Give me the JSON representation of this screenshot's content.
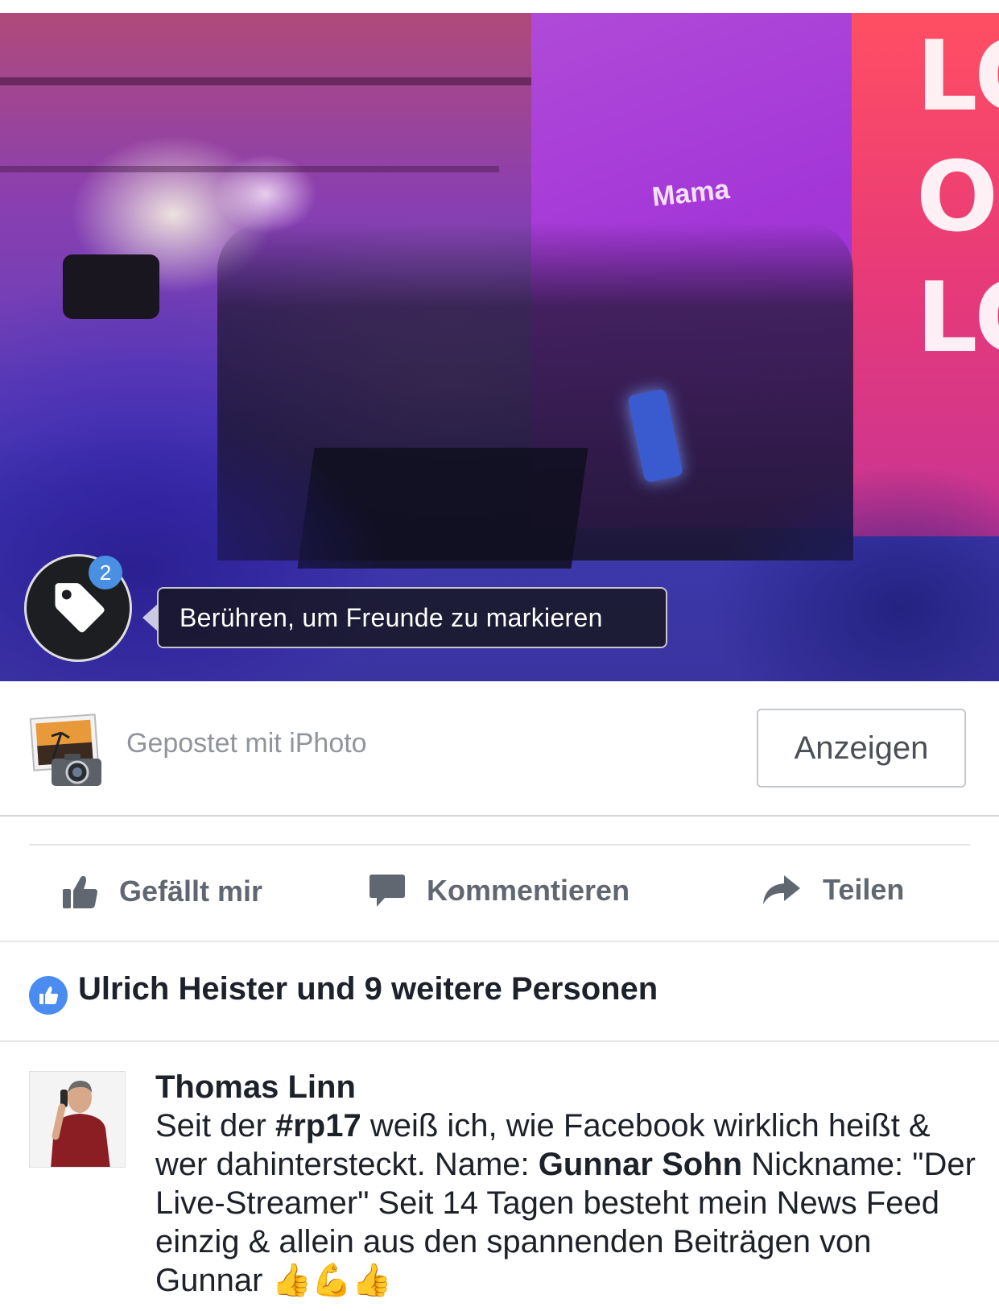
{
  "photo": {
    "banner_letters": [
      "LO",
      "O",
      "LO"
    ],
    "screen_text": "Mama",
    "tag_badge_count": "2",
    "tag_hint": "Berühren, um Freunde zu markieren",
    "tag_icon": "tag-icon"
  },
  "app_attribution": {
    "icon": "iphoto-icon",
    "label": "Gepostet mit iPhoto",
    "button_label": "Anzeigen"
  },
  "actions": {
    "like_label": "Gefällt mir",
    "comment_label": "Kommentieren",
    "share_label": "Teilen",
    "like_icon": "thumbs-up-icon",
    "comment_icon": "speech-bubble-icon",
    "share_icon": "share-arrow-icon"
  },
  "reactions": {
    "summary": "Ulrich Heister und 9 weitere Personen",
    "icon": "like-badge-icon",
    "accent_color": "#4a8cf0"
  },
  "comment": {
    "author": "Thomas Linn",
    "text_1": "Seit der ",
    "hashtag": "#rp17",
    "text_2": " weiß ich, wie Facebook wirklich heißt & wer dahintersteckt. Name: ",
    "name_bold": "Gunnar Sohn",
    "text_3": " Nickname: \"Der Live-Streamer\" Seit 14 Tagen besteht mein News Feed einzig & allein aus den spannenden Beiträgen von Gunnar ",
    "emoji": "👍💪👍"
  }
}
